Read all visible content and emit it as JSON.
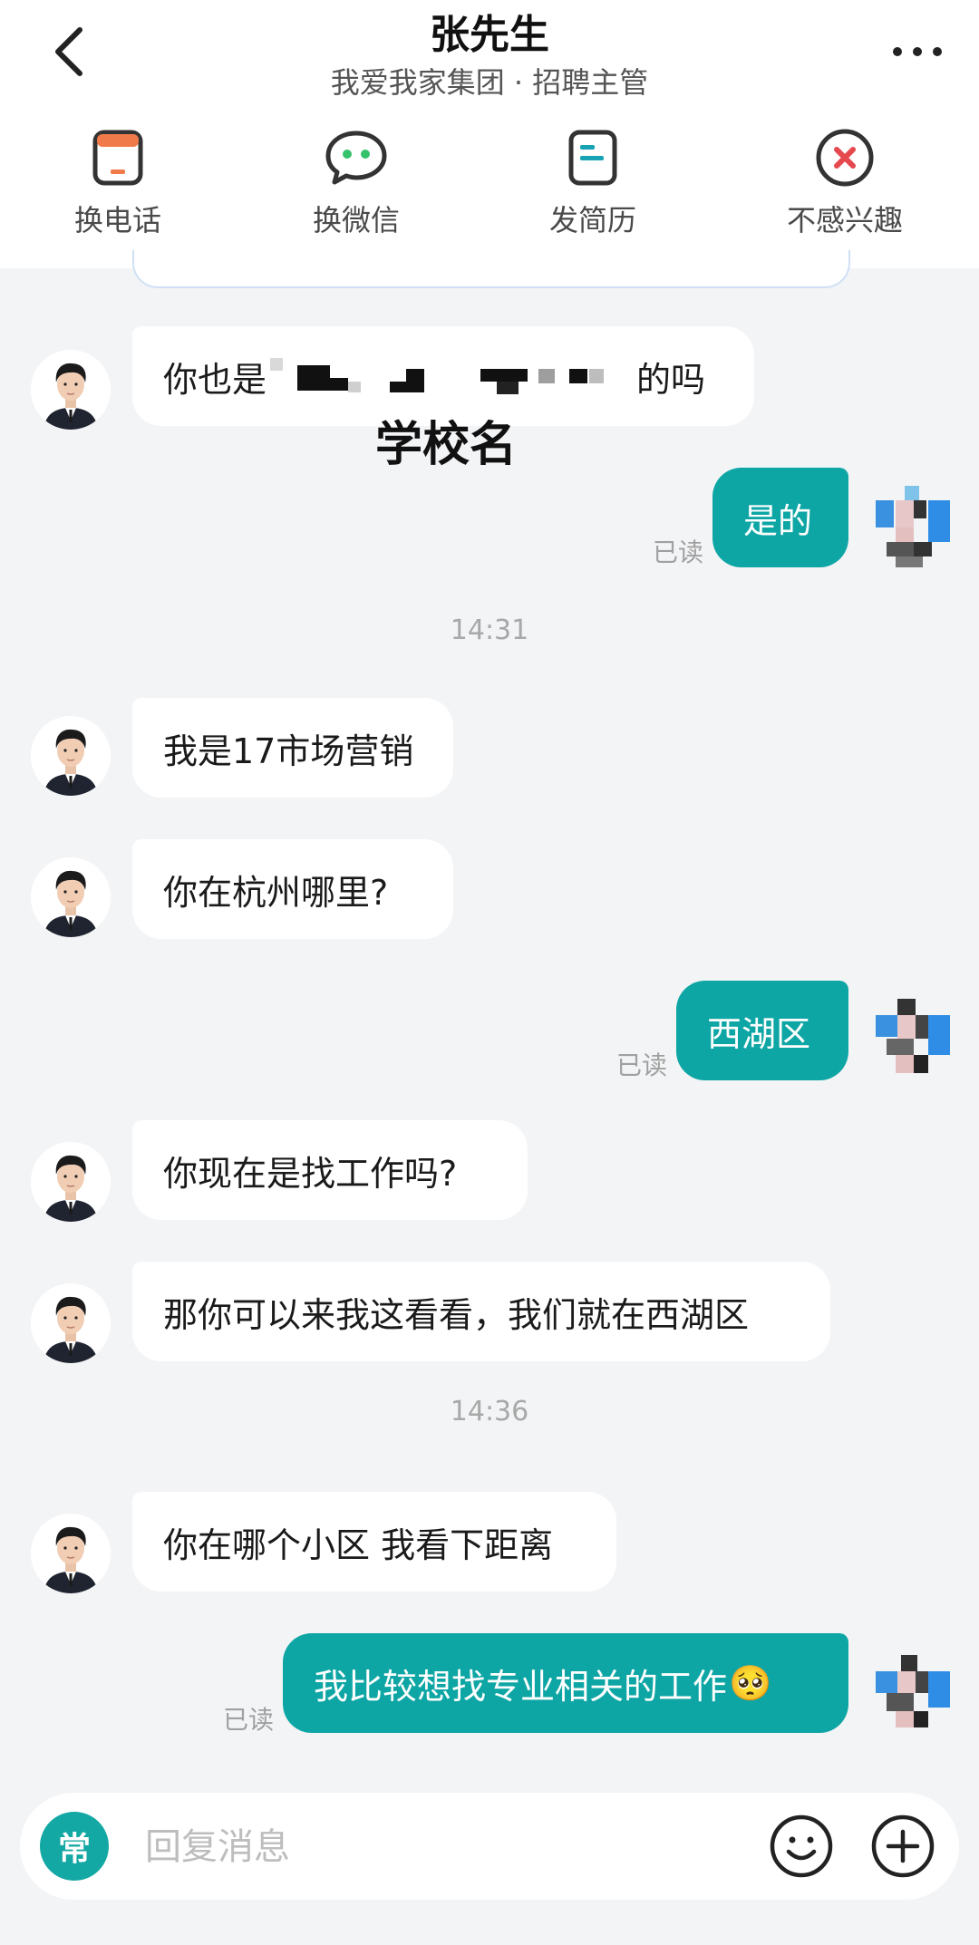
{
  "header": {
    "title": "张先生",
    "subtitle": "我爱我家集团 · 招聘主管",
    "back_icon": "chevron-left-icon",
    "more_icon": "more-dots-icon",
    "actions": [
      {
        "label": "换电话",
        "icon": "phone-card-icon",
        "color": "#f07a4a"
      },
      {
        "label": "换微信",
        "icon": "wechat-bubble-icon",
        "color": "#35c26b"
      },
      {
        "label": "发简历",
        "icon": "resume-doc-icon",
        "color": "#17a3b4"
      },
      {
        "label": "不感兴趣",
        "icon": "not-interested-icon",
        "color": "#e5484d"
      }
    ]
  },
  "messages": [
    {
      "side": "left",
      "text_before": "你也是",
      "text_after": "的吗",
      "redacted": true
    },
    {
      "side": "annotation",
      "text": "学校名"
    },
    {
      "side": "right",
      "text": "是的",
      "status": "已读"
    },
    {
      "side": "time",
      "text": "14:31"
    },
    {
      "side": "left",
      "text": "我是17市场营销"
    },
    {
      "side": "left",
      "text": "你在杭州哪里?"
    },
    {
      "side": "right",
      "text": "西湖区",
      "status": "已读"
    },
    {
      "side": "left",
      "text": "你现在是找工作吗?"
    },
    {
      "side": "left",
      "text": "那你可以来我这看看，我们就在西湖区"
    },
    {
      "side": "time",
      "text": "14:36"
    },
    {
      "side": "left",
      "text": "你在哪个小区 我看下距离"
    },
    {
      "side": "right",
      "text": "我比较想找专业相关的工作",
      "emoji": "🥺",
      "status": "已读"
    }
  ],
  "input": {
    "quick_label": "常",
    "placeholder": "回复消息",
    "emoji_icon": "smiley-icon",
    "plus_icon": "plus-circle-icon"
  },
  "colors": {
    "accent": "#0ea6a5",
    "background": "#f3f4f6",
    "bubble_left": "#ffffff"
  }
}
